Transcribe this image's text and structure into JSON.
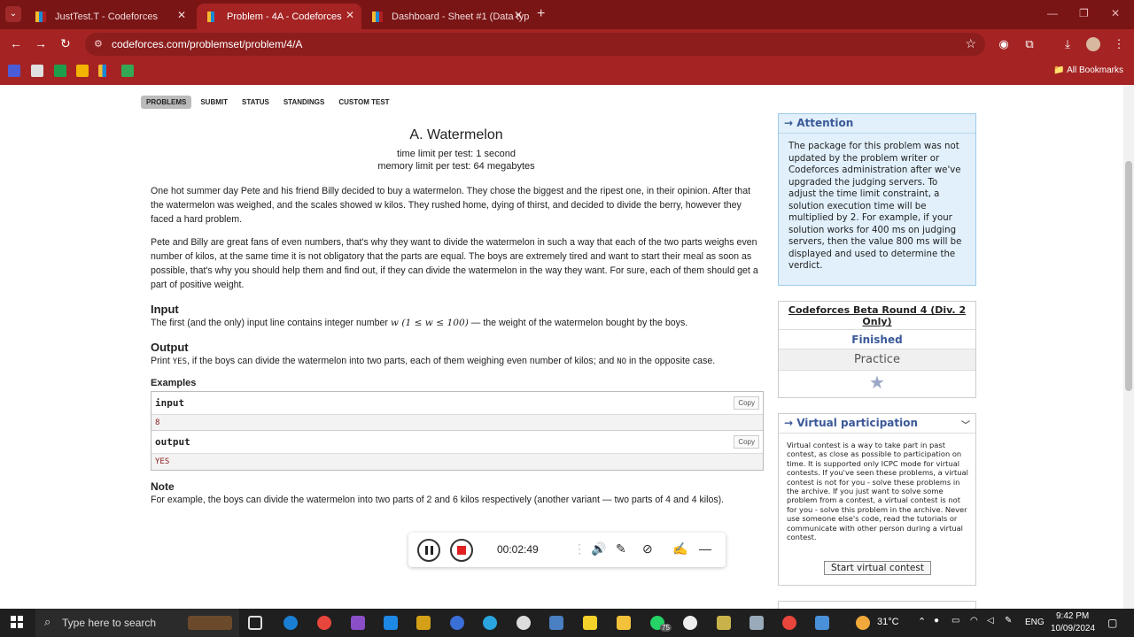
{
  "browser": {
    "tabs": [
      {
        "title": "JustTest.T - Codeforces"
      },
      {
        "title": "Problem - 4A - Codeforces"
      },
      {
        "title": "Dashboard - Sheet #1 (Data typ"
      }
    ],
    "url": "codeforces.com/problemset/problem/4/A",
    "all_bookmarks": "All Bookmarks"
  },
  "cf_menu": [
    "PROBLEMS",
    "SUBMIT",
    "STATUS",
    "STANDINGS",
    "CUSTOM TEST"
  ],
  "problem": {
    "title": "A. Watermelon",
    "time_limit": "time limit per test: 1 second",
    "memory_limit": "memory limit per test: 64 megabytes",
    "para1": "One hot summer day Pete and his friend Billy decided to buy a watermelon. They chose the biggest and the ripest one, in their opinion. After that the watermelon was weighed, and the scales showed w kilos. They rushed home, dying of thirst, and decided to divide the berry, however they faced a hard problem.",
    "para2": "Pete and Billy are great fans of even numbers, that's why they want to divide the watermelon in such a way that each of the two parts weighs even number of kilos, at the same time it is not obligatory that the parts are equal. The boys are extremely tired and want to start their meal as soon as possible, that's why you should help them and find out, if they can divide the watermelon in the way they want. For sure, each of them should get a part of positive weight.",
    "input_title": "Input",
    "input_text_a": "The first (and the only) input line contains integer number ",
    "input_math": "w (1 ≤ w ≤ 100)",
    "input_text_b": " — the weight of the watermelon bought by the boys.",
    "output_title": "Output",
    "output_text_a": "Print ",
    "output_yes": "YES",
    "output_text_b": ", if the boys can divide the watermelon into two parts, each of them weighing even number of kilos; and ",
    "output_no": "NO",
    "output_text_c": " in the opposite case.",
    "examples_title": "Examples",
    "example_input_label": "input",
    "example_input_value": "8",
    "example_output_label": "output",
    "example_output_value": "YES",
    "copy_label": "Copy",
    "note_title": "Note",
    "note_text": "For example, the boys can divide the watermelon into two parts of 2 and 6 kilos respectively (another variant — two parts of 4 and 4 kilos)."
  },
  "attention": {
    "title": "→ Attention",
    "body": "The package for this problem was not updated by the problem writer or Codeforces administration after we've upgraded the judging servers. To adjust the time limit constraint, a solution execution time will be multiplied by 2. For example, if your solution works for 400 ms on judging servers, then the value 800 ms will be displayed and used to determine the verdict."
  },
  "round": {
    "name": "Codeforces Beta Round 4 (Div. 2 Only)",
    "status": "Finished",
    "mode": "Practice"
  },
  "virtual": {
    "title": "→ Virtual participation",
    "body": "Virtual contest is a way to take part in past contest, as close as possible to participation on time. It is supported only ICPC mode for virtual contests. If you've seen these problems, a virtual contest is not for you - solve these problems in the archive. If you just want to solve some problem from a contest, a virtual contest is not for you - solve this problem in the archive. Never use someone else's code, read the tutorials or communicate with other person during a virtual contest.",
    "button": "Start virtual contest"
  },
  "recorder": {
    "time": "00:02:49"
  },
  "taskbar": {
    "search_placeholder": "Type here to search",
    "weather": "31°C",
    "lang": "ENG",
    "time": "9:42 PM",
    "date": "10/09/2024",
    "badge": "75"
  },
  "colors": {
    "chrome": "#a52323",
    "accent_blue": "#3b5998",
    "attention_bg": "#e1f0fb"
  }
}
